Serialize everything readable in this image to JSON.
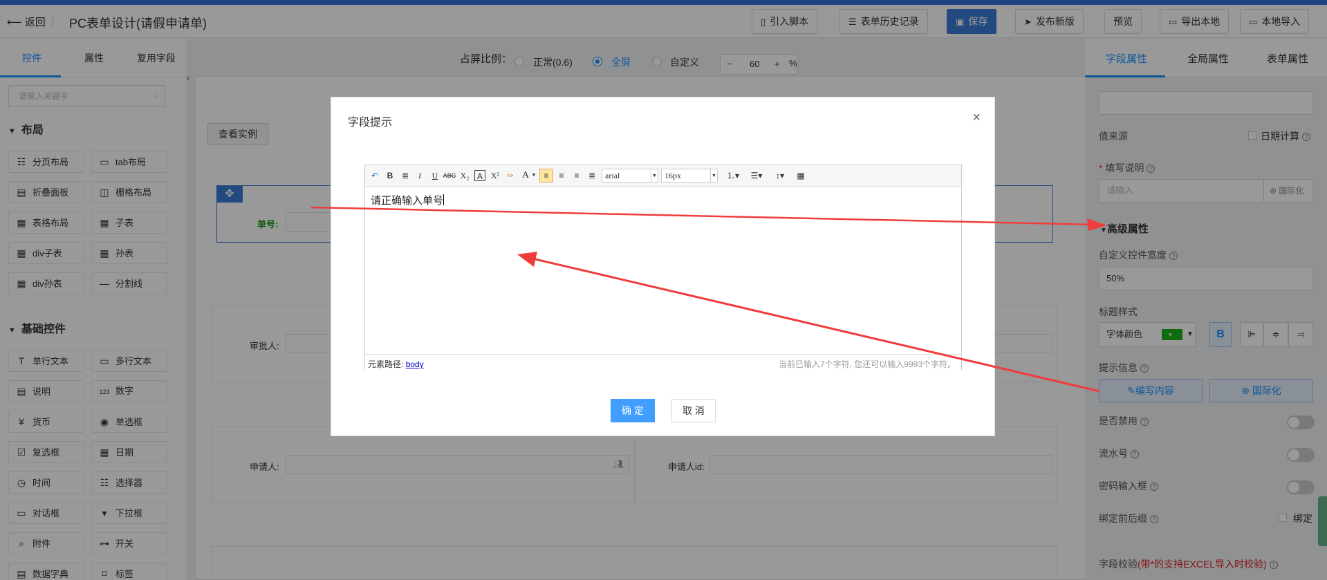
{
  "header": {
    "back_label": "返回",
    "title": "PC表单设计(请假申请单)",
    "buttons": {
      "import_script": "引入脚本",
      "history": "表单历史记录",
      "save": "保存",
      "publish": "发布新版",
      "preview": "预览",
      "export": "导出本地",
      "import": "本地导入"
    }
  },
  "left_panel": {
    "tabs": [
      "控件",
      "属性",
      "复用字段"
    ],
    "search_placeholder": "请输入关键字",
    "layout_section": "布局",
    "layout_items": [
      "分页布局",
      "tab布局",
      "折叠面板",
      "栅格布局",
      "表格布局",
      "子表",
      "div子表",
      "孙表",
      "div孙表",
      "分割线"
    ],
    "basic_section": "基础控件",
    "basic_items": [
      "单行文本",
      "多行文本",
      "说明",
      "数字",
      "货币",
      "单选框",
      "复选框",
      "日期",
      "时间",
      "选择器",
      "对话框",
      "下拉框",
      "附件",
      "开关",
      "数据字典",
      "标签"
    ]
  },
  "canvas": {
    "ratio_label": "占屏比例：",
    "ratio_options": [
      "正常(0.6)",
      "全屏",
      "自定义"
    ],
    "selected_ratio": "全屏",
    "scale_value": "60",
    "scale_minus": "−",
    "scale_plus": "+",
    "scale_unit": "%",
    "demo_button": "查看实例",
    "fields": {
      "order_no": "单号:",
      "approver": "审批人:",
      "applicant": "申请人:",
      "applicant_id": "申请人id:"
    }
  },
  "right_panel": {
    "tabs": [
      "字段属性",
      "全局属性",
      "表单属性"
    ],
    "value_source": "值来源",
    "date_calc": "日期计算",
    "fill_desc": "填写说明",
    "fill_desc_placeholder": "请输入",
    "i18n": "国际化",
    "advanced": "高级属性",
    "custom_width_label": "自定义控件宽度",
    "custom_width_value": "50%",
    "title_style": "标题样式",
    "font_color": "字体颜色",
    "font_color_value": "#19b319",
    "bold": "B",
    "tip_info": "提示信息",
    "edit_content": "编写内容",
    "i18n_btn": "国际化",
    "disabled": "是否禁用",
    "serial": "流水号",
    "password": "密码输入框",
    "bind_affix": "绑定前后缀",
    "bind": "绑定",
    "validation": "字段校验",
    "validation_note": "(带*的支持EXCEL导入时校验)"
  },
  "modal": {
    "title": "字段提示",
    "close": "×",
    "editor": {
      "font_family": "arial",
      "font_size": "16px",
      "content": "请正确输入单号",
      "path_label": "元素路径:",
      "path_link": "body",
      "char_count": "当前已输入7个字符, 您还可以输入9993个字符。"
    },
    "confirm": "确 定",
    "cancel": "取 消"
  },
  "colors": {
    "primary": "#1890ff",
    "annotation_arrow": "#f03c3c"
  }
}
